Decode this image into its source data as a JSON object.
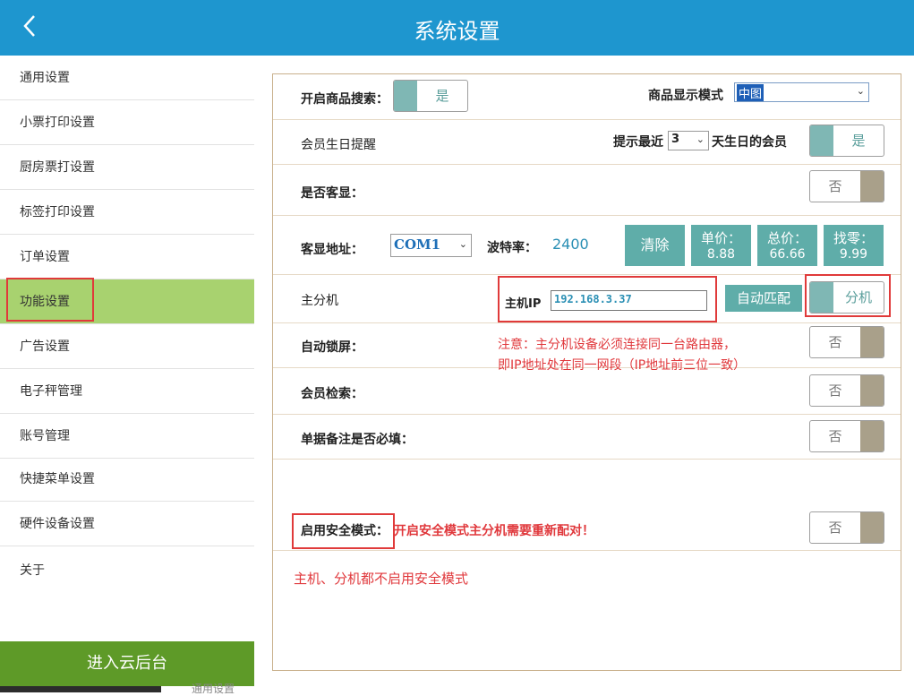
{
  "header": {
    "title": "系统设置",
    "back_icon": "chevron-left-icon"
  },
  "sidebar": {
    "items": [
      {
        "label": "通用设置"
      },
      {
        "label": "小票打印设置"
      },
      {
        "label": "厨房票打设置"
      },
      {
        "label": "标签打印设置"
      },
      {
        "label": "订单设置"
      },
      {
        "label": "功能设置"
      },
      {
        "label": "广告设置"
      },
      {
        "label": "电子秤管理"
      },
      {
        "label": "账号管理"
      },
      {
        "label": "快捷菜单设置"
      },
      {
        "label": "硬件设备设置"
      },
      {
        "label": "关于"
      }
    ],
    "active_index": 5,
    "cloud_button": "进入云后台"
  },
  "bottom": {
    "partial_text": "通用设置"
  },
  "settings": {
    "search": {
      "label": "开启商品搜索：",
      "toggle": "是"
    },
    "display_mode": {
      "label": "商品显示模式",
      "value": "中图"
    },
    "birthday": {
      "label": "会员生日提醒",
      "prefix": "提示最近",
      "days": "3",
      "suffix": "天生日的会员",
      "toggle": "是"
    },
    "customer_display": {
      "label": "是否客显：",
      "toggle": "否"
    },
    "display_address": {
      "label": "客显地址：",
      "port": "COM1",
      "baud_label": "波特率：",
      "baud_value": "2400",
      "clear_btn": "清除",
      "unit_price_label": "单价：",
      "unit_price_value": "8.88",
      "total_label": "总价：",
      "total_value": "66.66",
      "change_label": "找零：",
      "change_value": "9.99"
    },
    "master_slave": {
      "label": "主分机",
      "host_ip_label": "主机IP",
      "host_ip": "192.168.3.37",
      "auto_match_btn": "自动匹配",
      "toggle": "分机"
    },
    "auto_lock": {
      "label": "自动锁屏：",
      "toggle": "否"
    },
    "note_line1": "注意：主分机设备必须连接同一台路由器，",
    "note_line2": "即IP地址处在同一网段（IP地址前三位一致）",
    "member_search": {
      "label": "会员检索：",
      "toggle": "否"
    },
    "remark_required": {
      "label": "单据备注是否必填：",
      "toggle": "否"
    },
    "safe_mode": {
      "label": "启用安全模式：",
      "warning": "开启安全模式主分机需要重新配对！",
      "toggle": "否"
    },
    "safe_mode_note": "主机、分机都不启用安全模式"
  },
  "colors": {
    "header": "#1e96cf",
    "active_item": "#a8d26f",
    "cloud_button": "#5e9a28",
    "teal": "#5fada9",
    "highlight_red": "#e03a3a"
  }
}
